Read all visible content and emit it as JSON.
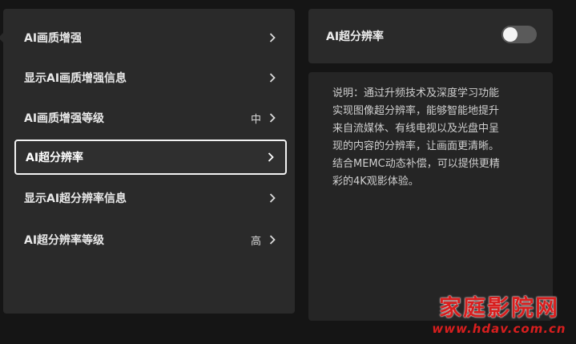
{
  "menu": {
    "items": [
      {
        "label": "AI画质增强",
        "value": ""
      },
      {
        "label": "显示AI画质增强信息",
        "value": ""
      },
      {
        "label": "AI画质增强等级",
        "value": "中"
      },
      {
        "label": "AI超分辨率",
        "value": "",
        "selected": true
      },
      {
        "label": "显示AI超分辨率信息",
        "value": ""
      },
      {
        "label": "AI超分辨率等级",
        "value": "高"
      }
    ]
  },
  "detail": {
    "title": "AI超分辨率",
    "toggle_on": false,
    "description_lines": [
      "说明：通过升频技术及深度学习功能",
      "实现图像超分辨率，能够智能地提升",
      "来自流媒体、有线电视以及光盘中呈",
      "现的内容的分辨率，让画面更清晰。",
      "结合MEMC动态补偿，可以提供更精",
      "彩的4K观影体验。"
    ]
  },
  "watermark": {
    "main": "家庭影院网",
    "url": "www.hdav.com.cn"
  },
  "colors": {
    "panel": "#2a2a2a",
    "background": "#151515",
    "watermark": "#d81e1e",
    "toggle_track": "#5a5a5a"
  },
  "icons": {
    "chevron": "chevron-right-icon"
  }
}
